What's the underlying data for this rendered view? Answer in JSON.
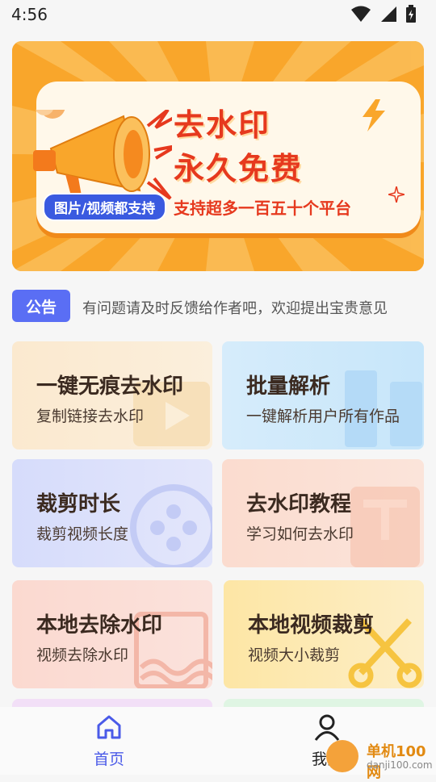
{
  "status_bar": {
    "time": "4:56"
  },
  "banner": {
    "headline_1": "去水印",
    "headline_2": "永久免费",
    "pill": "图片/视频都支持",
    "subline": "支持超多一百五十个平台"
  },
  "notice": {
    "tag": "公告",
    "text": "有问题请及时反馈给作者吧，欢迎提出宝贵意见"
  },
  "tiles": [
    {
      "title": "一键无痕去水印",
      "subtitle": "复制链接去水印"
    },
    {
      "title": "批量解析",
      "subtitle": "一键解析用户所有作品"
    },
    {
      "title": "裁剪时长",
      "subtitle": "裁剪视频长度"
    },
    {
      "title": "去水印教程",
      "subtitle": "学习如何去水印"
    },
    {
      "title": "本地去除水印",
      "subtitle": "视频去除水印"
    },
    {
      "title": "本地视频裁剪",
      "subtitle": "视频大小裁剪"
    }
  ],
  "nav": {
    "home": "首页",
    "mine": "我的"
  },
  "watermark": {
    "brand": "单机100网",
    "url": "danji100.com"
  },
  "colors": {
    "accent": "#5a6ef4",
    "banner_orange": "#f9a62b",
    "headline_red": "#e6391e",
    "nav_active": "#4a5ae8"
  }
}
